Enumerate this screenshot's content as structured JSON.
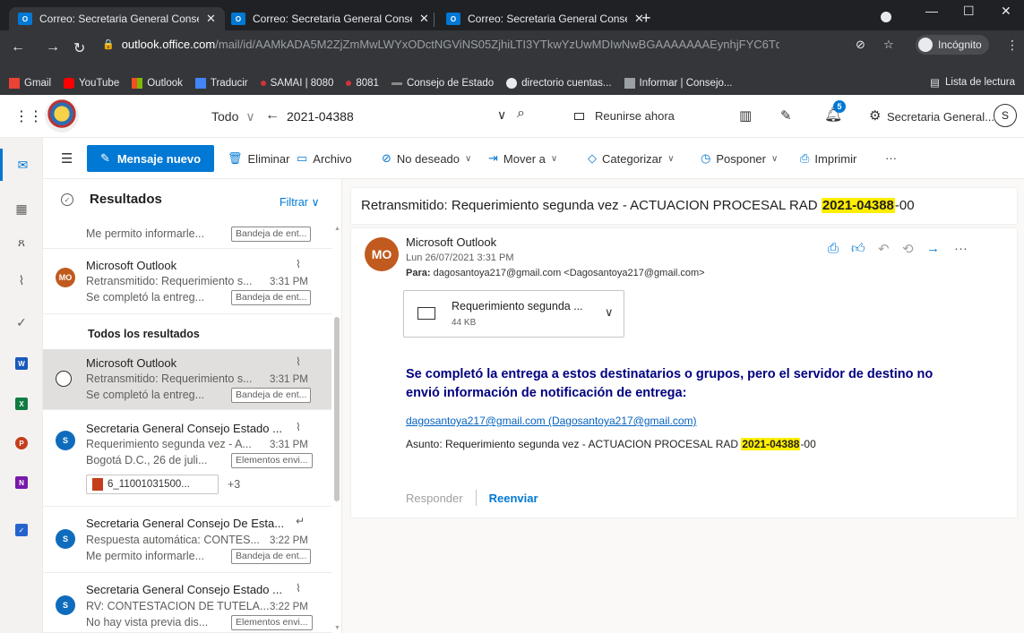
{
  "browser": {
    "tabs": [
      {
        "title": "Correo: Secretaria General Conse",
        "active": true
      },
      {
        "title": "Correo: Secretaria General Conse",
        "active": false
      },
      {
        "title": "Correo: Secretaria General Conse",
        "active": false
      }
    ],
    "url_host": "outlook.office.com",
    "url_path": "/mail/id/AAMkADA5M2ZjZmMwLWYxODctNGViNS05ZjhiLTI3YTkwYzUwMDIwNwBGAAAAAAAEynhjFYC6TqARZiRYN9...",
    "incognito_label": "Incógnito",
    "bookmarks": [
      {
        "label": "Gmail",
        "icon": "gmail-icon"
      },
      {
        "label": "YouTube",
        "icon": "youtube-icon"
      },
      {
        "label": "Outlook",
        "icon": "outlook-icon"
      },
      {
        "label": "Traducir",
        "icon": "translate-icon"
      },
      {
        "label": "SAMAI | 8080",
        "icon": "samai-icon"
      },
      {
        "label": "8081",
        "icon": "samai-icon"
      },
      {
        "label": "Consejo de Estado",
        "icon": "consejo-icon"
      },
      {
        "label": "directorio cuentas...",
        "icon": "globe-icon"
      },
      {
        "label": "Informar | Consejo...",
        "icon": "consejo-icon"
      }
    ],
    "reading_list_label": "Lista de lectura"
  },
  "owa": {
    "search_scope": "Todo",
    "search_value": "2021-04388",
    "meet_now_label": "Reunirse ahora",
    "notification_count": "5",
    "account_name": "Secretaria General...",
    "account_initial": "S",
    "new_message_label": "Mensaje nuevo",
    "commands": [
      {
        "label": "Eliminar",
        "icon": "trash-icon"
      },
      {
        "label": "Archivo",
        "icon": "archive-icon"
      },
      {
        "label": "No deseado",
        "icon": "junk-icon"
      },
      {
        "label": "Mover a",
        "icon": "move-icon"
      },
      {
        "label": "Categorizar",
        "icon": "tag-icon"
      },
      {
        "label": "Posponer",
        "icon": "clock-icon"
      },
      {
        "label": "Imprimir",
        "icon": "print-icon"
      }
    ]
  },
  "list": {
    "title": "Resultados",
    "filter_label": "Filtrar",
    "section_label": "Todos los resultados",
    "items": [
      {
        "sender": "",
        "subject": "",
        "time": "",
        "preview": "Me permito informarle...",
        "folder": "Bandeja de ent..."
      },
      {
        "sender": "Microsoft Outlook",
        "subject": "Retransmitido: Requerimiento s...",
        "time": "3:31 PM",
        "preview": "Se completó la entreg...",
        "folder": "Bandeja de ent...",
        "avatar": "MO"
      },
      {
        "sender": "Microsoft Outlook",
        "subject": "Retransmitido: Requerimiento s...",
        "time": "3:31 PM",
        "preview": "Se completó la entreg...",
        "folder": "Bandeja de ent..."
      },
      {
        "sender": "Secretaria General Consejo Estado ...",
        "subject": "Requerimiento segunda vez - A...",
        "time": "3:31 PM",
        "preview": "Bogotá D.C., 26 de juli...",
        "folder": "Elementos envi...",
        "avatar": "S",
        "attachment": "6_11001031500...",
        "more": "+3"
      },
      {
        "sender": "Secretaria General Consejo De Esta...",
        "subject": "Respuesta automática: CONTES...",
        "time": "3:22 PM",
        "preview": "Me permito informarle...",
        "folder": "Bandeja de ent...",
        "avatar": "S"
      },
      {
        "sender": "Secretaria General Consejo Estado ...",
        "subject": "RV: CONTESTACION DE TUTELA...",
        "time": "3:22 PM",
        "preview": "No hay vista previa dis...",
        "folder": "Elementos envi...",
        "avatar": "S"
      }
    ]
  },
  "message": {
    "subject_prefix": "Retransmitido: Requerimiento segunda vez - ACTUACION PROCESAL RAD ",
    "subject_highlight": "2021-04388",
    "subject_suffix": "-00",
    "from": "Microsoft Outlook",
    "avatar": "MO",
    "date": "Lun 26/07/2021 3:31 PM",
    "to_label": "Para:",
    "to": "dagosantoya217@gmail.com <Dagosantoya217@gmail.com>",
    "attachment_name": "Requerimiento segunda ...",
    "attachment_size": "44 KB",
    "notice": "Se completó la entrega a estos destinatarios o grupos, pero el servidor de destino no envió información de notificación de entrega:",
    "recipient_link": "dagosantoya217@gmail.com (Dagosantoya217@gmail.com)",
    "asunto_prefix": "Asunto: Requerimiento segunda vez - ACTUACION PROCESAL RAD ",
    "asunto_highlight": "2021-04388",
    "asunto_suffix": "-00",
    "reply_label": "Responder",
    "forward_label": "Reenviar"
  },
  "colors": {
    "accent": "#0078d4",
    "highlight": "#ffee00",
    "notice_text": "#000080",
    "avatar_mo": "#c05a1e",
    "avatar_s": "#0f6cbd"
  }
}
